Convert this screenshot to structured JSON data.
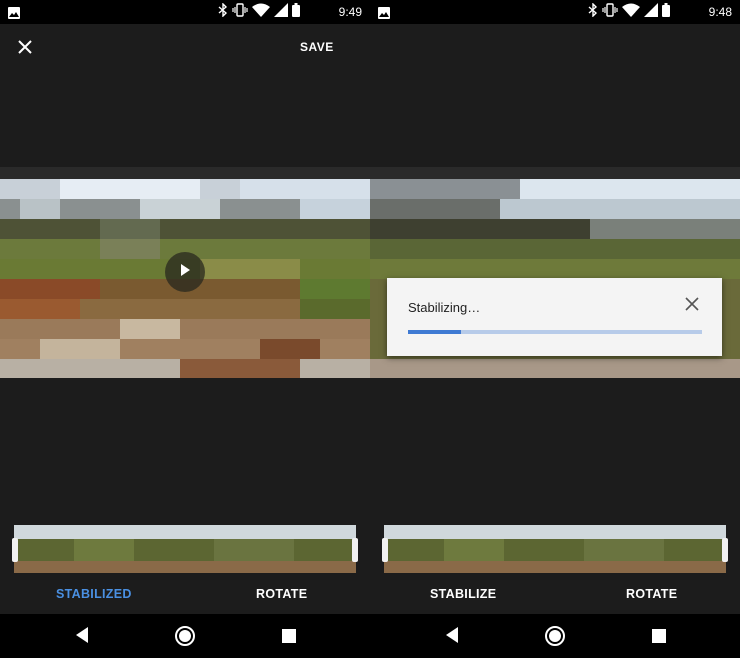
{
  "left": {
    "status": {
      "time": "9:49"
    },
    "toolbar": {
      "save_label": "SAVE"
    },
    "tabs": {
      "stabilize_label": "STABILIZED",
      "rotate_label": "ROTATE"
    }
  },
  "right": {
    "status": {
      "time": "9:48"
    },
    "dialog": {
      "title": "Stabilizing…",
      "progress": 0.18
    },
    "tabs": {
      "stabilize_label": "STABILIZE",
      "rotate_label": "ROTATE"
    }
  },
  "colors": {
    "accent": "#4a90e2",
    "panel_bg": "#1c1c1c",
    "progress_fill": "#3f7ad3",
    "progress_track": "#b7cbe9"
  },
  "icons": [
    "photo-icon",
    "bluetooth-icon",
    "vibrate-icon",
    "wifi-icon",
    "signal-icon",
    "battery-icon",
    "close-icon",
    "play-icon",
    "back-icon",
    "home-icon",
    "recents-icon"
  ]
}
